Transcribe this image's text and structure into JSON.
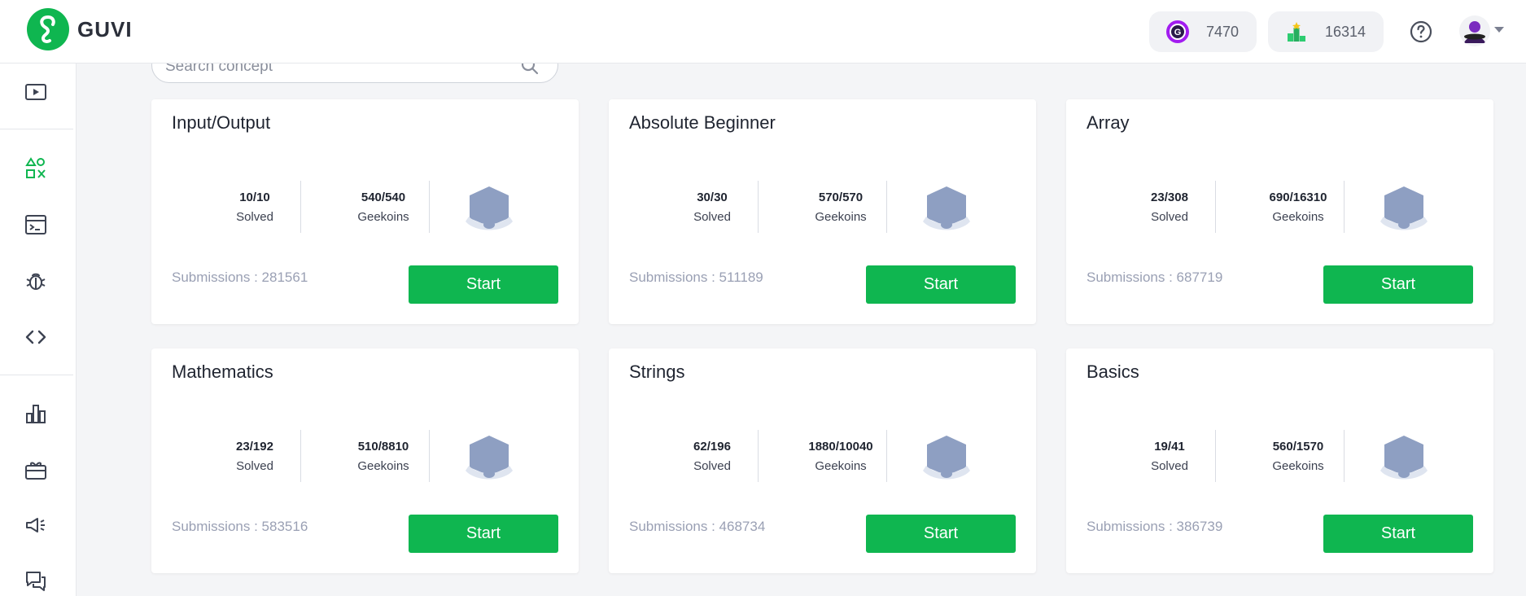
{
  "brand": {
    "name": "GUVI"
  },
  "header": {
    "geekoins": "7470",
    "rank": "16314"
  },
  "search": {
    "placeholder": "Search concept"
  },
  "colors": {
    "accent": "#0fb650",
    "badge": "#8e9fc2"
  },
  "cards": [
    {
      "title": "Input/Output",
      "solved_value": "10/10",
      "solved_label": "Solved",
      "geekoins_value": "540/540",
      "geekoins_label": "Geekoins",
      "submissions": "Submissions : 281561",
      "button": "Start"
    },
    {
      "title": "Absolute Beginner",
      "solved_value": "30/30",
      "solved_label": "Solved",
      "geekoins_value": "570/570",
      "geekoins_label": "Geekoins",
      "submissions": "Submissions : 511189",
      "button": "Start"
    },
    {
      "title": "Array",
      "solved_value": "23/308",
      "solved_label": "Solved",
      "geekoins_value": "690/16310",
      "geekoins_label": "Geekoins",
      "submissions": "Submissions : 687719",
      "button": "Start"
    },
    {
      "title": "Mathematics",
      "solved_value": "23/192",
      "solved_label": "Solved",
      "geekoins_value": "510/8810",
      "geekoins_label": "Geekoins",
      "submissions": "Submissions : 583516",
      "button": "Start"
    },
    {
      "title": "Strings",
      "solved_value": "62/196",
      "solved_label": "Solved",
      "geekoins_value": "1880/10040",
      "geekoins_label": "Geekoins",
      "submissions": "Submissions : 468734",
      "button": "Start"
    },
    {
      "title": "Basics",
      "solved_value": "19/41",
      "solved_label": "Solved",
      "geekoins_value": "560/1570",
      "geekoins_label": "Geekoins",
      "submissions": "Submissions : 386739",
      "button": "Start"
    }
  ],
  "sidebar_icons": [
    "video-icon",
    "shapes-icon",
    "terminal-icon",
    "bug-icon",
    "code-icon",
    "chart-icon",
    "gift-icon",
    "megaphone-icon",
    "chat-icon"
  ]
}
